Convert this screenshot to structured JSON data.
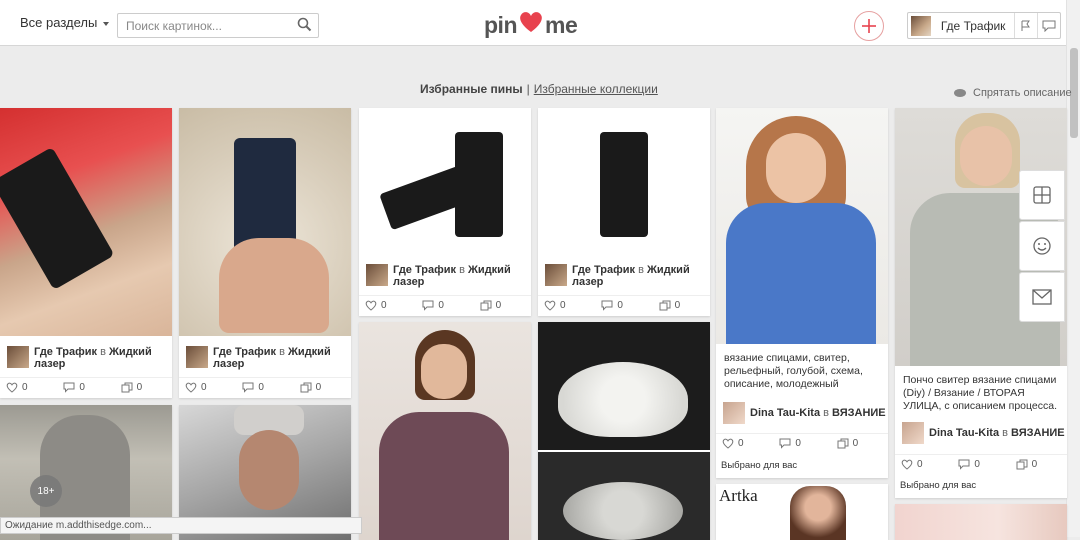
{
  "header": {
    "sections_label": "Все разделы",
    "search_placeholder": "Поиск картинок...",
    "logo_left": "pin",
    "logo_right": "me",
    "user_name": "Где Трафик"
  },
  "tabs": {
    "active": "Избранные пины",
    "separator": "|",
    "collections": "Избранные коллекции"
  },
  "hide_description": "Спрятать описание",
  "cards": [
    {
      "pinner": "Где Трафик",
      "in": "в",
      "board": "Жидкий лазер",
      "likes": "0",
      "comments": "0",
      "repins": "0"
    },
    {
      "pinner": "Где Трафик",
      "in": "в",
      "board": "Жидкий лазер",
      "likes": "0",
      "comments": "0",
      "repins": "0"
    },
    {
      "pinner": "Где Трафик",
      "in": "в",
      "board": "Жидкий лазер",
      "likes": "0",
      "comments": "0",
      "repins": "0"
    },
    {
      "pinner": "Где Трафик",
      "in": "в",
      "board": "Жидкий лазер",
      "likes": "0",
      "comments": "0",
      "repins": "0"
    },
    {
      "desc": "вязание спицами, свитер, рельефный, голубой, схема, описание, молодежный",
      "pinner": "Dina Tau-Kita",
      "in": "в",
      "board": "ВЯЗАНИЕ",
      "likes": "0",
      "comments": "0",
      "repins": "0",
      "for_you": "Выбрано для вас"
    },
    {
      "desc": "Пончо свитер вязание спицами (Diy) / Вязание / ВТОРАЯ УЛИЦА, с описанием процесса.",
      "pinner": "Dina Tau-Kita",
      "in": "в",
      "board": "ВЯЗАНИЕ",
      "likes": "0",
      "comments": "0",
      "repins": "0",
      "for_you": "Выбрано для вас"
    }
  ],
  "artka_label": "Artka",
  "age_badge": "18+",
  "status_text": "Ожидание m.addthisedge.com..."
}
